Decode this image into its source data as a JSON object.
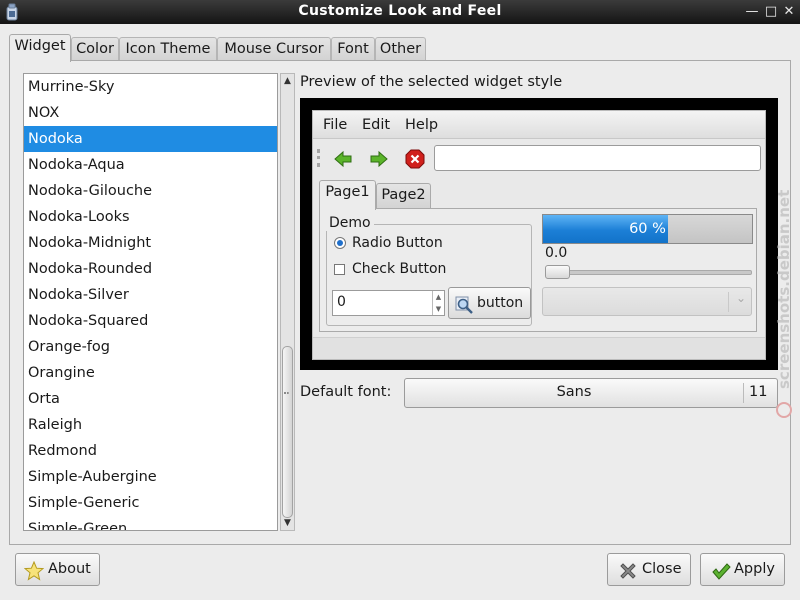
{
  "window": {
    "title": "Customize Look and Feel"
  },
  "tabs": [
    {
      "label": "Widget",
      "active": true
    },
    {
      "label": "Color",
      "active": false
    },
    {
      "label": "Icon Theme",
      "active": false
    },
    {
      "label": "Mouse Cursor",
      "active": false
    },
    {
      "label": "Font",
      "active": false
    },
    {
      "label": "Other",
      "active": false
    }
  ],
  "theme_list": {
    "selected": "Nodoka",
    "items": [
      "Murrine-Sky",
      "NOX",
      "Nodoka",
      "Nodoka-Aqua",
      "Nodoka-Gilouche",
      "Nodoka-Looks",
      "Nodoka-Midnight",
      "Nodoka-Rounded",
      "Nodoka-Silver",
      "Nodoka-Squared",
      "Orange-fog",
      "Orangine",
      "Orta",
      "Raleigh",
      "Redmond",
      "Simple-Aubergine",
      "Simple-Generic",
      "Simple-Green"
    ]
  },
  "preview": {
    "label": "Preview of the selected widget style",
    "menu": [
      "File",
      "Edit",
      "Help"
    ],
    "toolbar_icons": [
      "back-arrow-icon",
      "forward-arrow-icon",
      "stop-icon"
    ],
    "tabs": [
      "Page1",
      "Page2"
    ],
    "demo_title": "Demo",
    "radio_label": "Radio Button",
    "check_label": "Check Button",
    "spin_value": "0",
    "button_label": "button",
    "progress_percent": 60,
    "progress_text": "60 %",
    "slider_value": "0.0"
  },
  "font": {
    "label": "Default font:",
    "name": "Sans",
    "size": "11"
  },
  "buttons": {
    "about": "About",
    "close": "Close",
    "apply": "Apply"
  },
  "watermark": "screenshots.debian.net",
  "colors": {
    "selection": "#1f8ce3",
    "titlebar": "#1f1f1f",
    "progress": "#1c7fd6"
  }
}
